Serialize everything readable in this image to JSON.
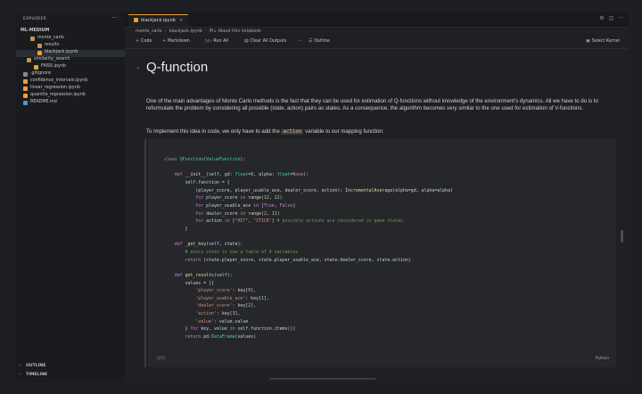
{
  "sidebar": {
    "title": "EXPLORER",
    "more": "···",
    "root": "ML-MEDIUM",
    "items": [
      {
        "label": "monte_carlo",
        "kind": "folder"
      },
      {
        "label": "results",
        "kind": "folder"
      },
      {
        "label": "blackjack.ipynb",
        "kind": "notebook"
      },
      {
        "label": "similarity_search",
        "kind": "folder"
      },
      {
        "label": "FAISS.ipynb",
        "kind": "notebook"
      },
      {
        "label": ".gitignore",
        "kind": "file"
      },
      {
        "label": "confidence_intervals.ipynb",
        "kind": "notebook"
      },
      {
        "label": "linear_regression.ipynb",
        "kind": "notebook"
      },
      {
        "label": "quantile_regression.ipynb",
        "kind": "notebook"
      },
      {
        "label": "README.md",
        "kind": "markdown"
      }
    ],
    "sections": [
      "OUTLINE",
      "TIMELINE"
    ]
  },
  "tab": {
    "label": "blackjack.ipynb",
    "close": "×"
  },
  "breadcrumbs": [
    "monte_carlo",
    "blackjack.ipynb",
    "M↓ About this notebook"
  ],
  "toolbar": {
    "code": "Code",
    "markdown": "Markdown",
    "run_all": "Run All",
    "clear": "Clear All Outputs",
    "outline": "Outline",
    "kernel": "Select Kernel"
  },
  "heading": "Q-function",
  "paragraph": "One of the main advantages of Monte Carlo methods is the fact that they can be used for estimation of Q-functions without knowledge of the environment's dynamics. All we have to do is to reformulate the problem by considering all possible (state, action) pairs as states. As a consequence, the algorithm becomes very similar to the one used for estimation of V-functions.",
  "paragraph2": {
    "before": "To implement this idea in code, we only have to add the ",
    "code": "action",
    "after": " variable to our mapping function:"
  },
  "cell": {
    "exec_count": "[25]",
    "language": "Python"
  },
  "colors": {
    "accent": "#e8a13a",
    "keyword": "#c586c0",
    "function": "#dcdcaa",
    "class": "#4ec9b0",
    "string": "#ce9178"
  }
}
